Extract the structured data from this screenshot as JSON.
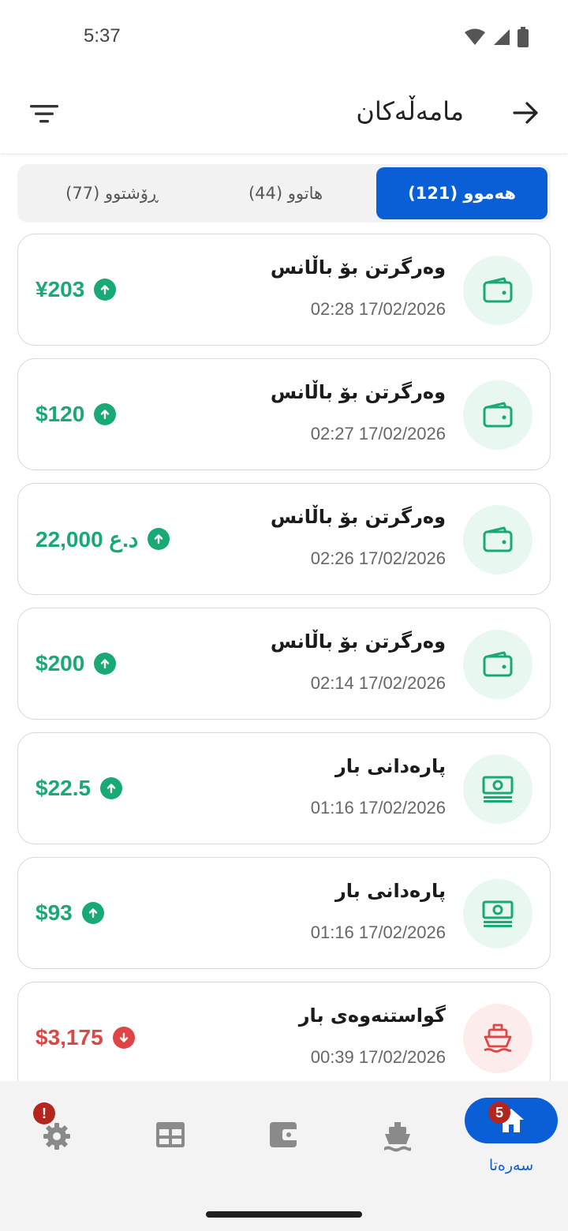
{
  "status_bar": {
    "time": "5:37"
  },
  "app_bar": {
    "title": "مامەڵەکان",
    "filter_icon": "filter-icon",
    "back_icon": "arrow-right-icon"
  },
  "tabs": [
    {
      "label": "هەموو (121)",
      "selected": true
    },
    {
      "label": "هاتوو (44)",
      "selected": false
    },
    {
      "label": "ڕۆشتوو (77)",
      "selected": false
    }
  ],
  "transactions": [
    {
      "title": "وەرگرتن بۆ باڵانس",
      "datetime": "02:28 17/02/2026",
      "amount": "¥203",
      "direction": "in",
      "icon": "wallet-icon"
    },
    {
      "title": "وەرگرتن بۆ باڵانس",
      "datetime": "02:27 17/02/2026",
      "amount": "$120",
      "direction": "in",
      "icon": "wallet-icon"
    },
    {
      "title": "وەرگرتن بۆ باڵانس",
      "datetime": "02:26 17/02/2026",
      "amount": "22,000 د.ع",
      "direction": "in",
      "icon": "wallet-icon"
    },
    {
      "title": "وەرگرتن بۆ باڵانس",
      "datetime": "02:14 17/02/2026",
      "amount": "$200",
      "direction": "in",
      "icon": "wallet-icon"
    },
    {
      "title": "پارەدانی بار",
      "datetime": "01:16 17/02/2026",
      "amount": "$22.5",
      "direction": "in",
      "icon": "cash-icon"
    },
    {
      "title": "پارەدانی بار",
      "datetime": "01:16 17/02/2026",
      "amount": "$93",
      "direction": "in",
      "icon": "cash-icon"
    },
    {
      "title": "گواستنەوەی بار",
      "datetime": "00:39 17/02/2026",
      "amount": "$3,175",
      "direction": "out",
      "icon": "ship-icon"
    }
  ],
  "bottom_nav": {
    "home_label": "سەرەتا",
    "home_badge": "5",
    "settings_badge": "!"
  },
  "colors": {
    "primary": "#0a5fd6",
    "incoming": "#19a974",
    "outgoing": "#e04545",
    "badge": "#b3261e"
  }
}
